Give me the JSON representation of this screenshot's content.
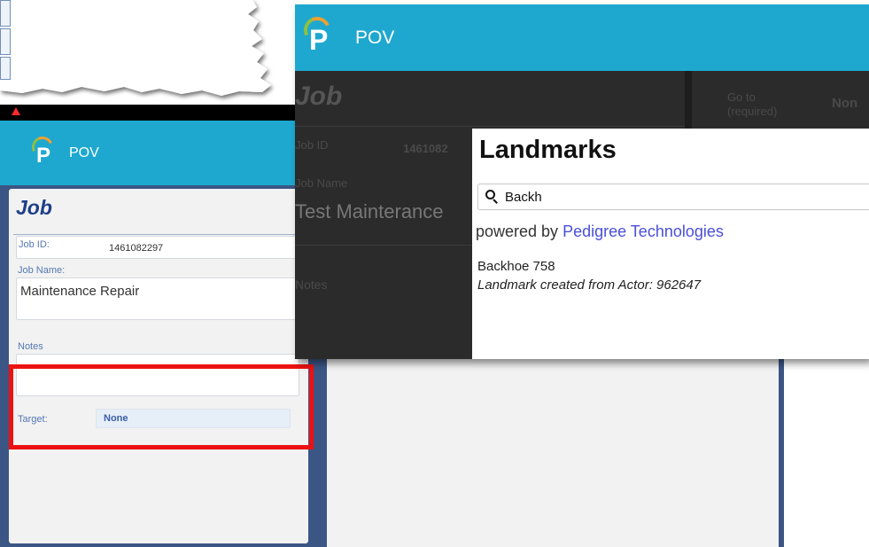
{
  "colors": {
    "appbar": "#1ea8cf",
    "dialog_background": "#3b5585",
    "card_background": "#f2f2f2",
    "heading": "#1e3f88",
    "label": "#5478b4",
    "highlight_border": "#ee1111",
    "brand_link": "#4a4fd8",
    "tablet_dim_background": "#2b2b2b"
  },
  "phone": {
    "status_bar": {
      "icon": "warning-icon"
    },
    "app_bar": {
      "title": "POV",
      "logo_letter": "P",
      "logo_icon": "pov-logo-icon"
    },
    "job_form": {
      "heading": "Job",
      "job_id_label": "Job ID:",
      "job_id_value": "1461082297",
      "job_name_label": "Job Name:",
      "job_name_value": "Maintenance Repair",
      "notes_label": "Notes",
      "notes_value": "",
      "target_label": "Target:",
      "target_value": "None"
    }
  },
  "tablet": {
    "app_bar": {
      "title": "POV",
      "logo_letter": "P",
      "logo_icon": "pov-logo-icon"
    },
    "background_form": {
      "heading": "Job",
      "job_id_label": "Job ID",
      "job_id_value": "1461082",
      "job_name_label": "Job Name",
      "job_name_value": "Test Mainterance",
      "notes_label": "Notes",
      "goto_label": "Go to (required)",
      "goto_value": "Non"
    },
    "landmarks_dialog": {
      "title": "Landmarks",
      "search_icon": "search-icon",
      "search_value": "Backh",
      "powered_prefix": "powered by",
      "powered_brand": "Pedigree Technologies",
      "results": [
        {
          "name": "Backhoe 758",
          "description": "Landmark created from Actor: 962647"
        }
      ]
    }
  }
}
